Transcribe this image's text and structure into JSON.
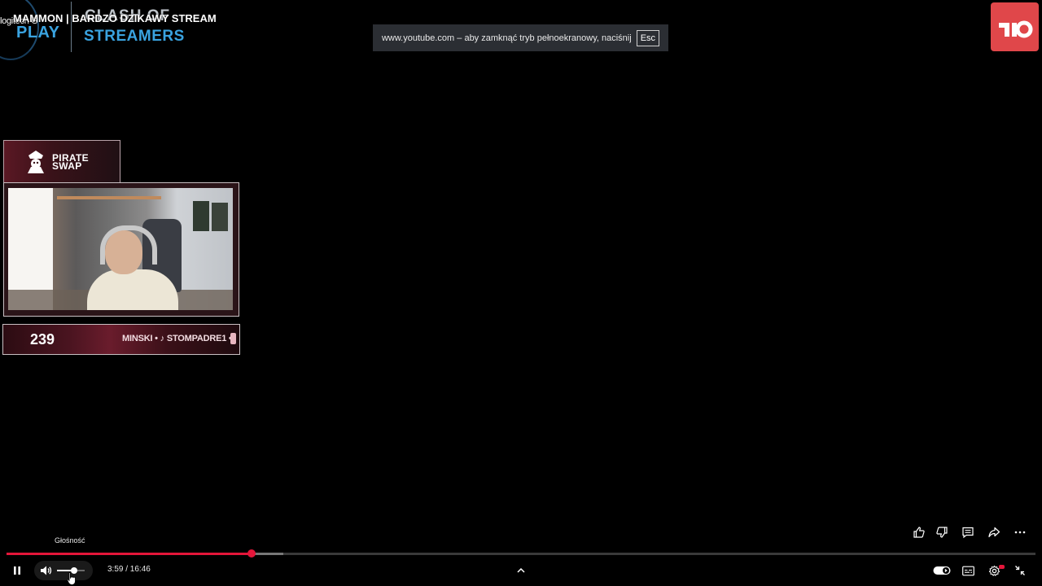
{
  "branding": {
    "logitech": "logitech G",
    "play": "PLAY",
    "clash": "CLASH OF",
    "streamers": "STREAMERS"
  },
  "video": {
    "title": "MAMMON | BARDZO DZIKAWY STREAM"
  },
  "fullscreen_notice": {
    "text": "www.youtube.com – aby zamknąć tryb pełnoekranowy, naciśnij",
    "key": "Esc"
  },
  "overlay": {
    "sponsor_line1": "PIRATE",
    "sponsor_line2": "SWAP",
    "viewer_count": "239",
    "ticker_text": "MINSKI • ♪ STOMPADRE1 •"
  },
  "tooltip": {
    "label": "Głośność"
  },
  "player": {
    "current_time": "3:59",
    "duration": "16:46",
    "time_display": "3:59 / 16:46",
    "progress_fraction": 0.238,
    "buffered_fraction": 0.269,
    "volume_fraction": 0.62,
    "accent_color": "#e4163a"
  },
  "icons": {
    "pause": "pause-icon",
    "volume": "volume-icon",
    "chevron_up": "chevron-up-icon",
    "autoplay": "autoplay-toggle-icon",
    "subtitles": "subtitles-icon",
    "settings": "settings-icon",
    "exit_fullscreen": "exit-fullscreen-icon",
    "like": "like-icon",
    "dislike": "dislike-icon",
    "comments": "comments-icon",
    "share": "share-icon",
    "more": "more-icon"
  }
}
